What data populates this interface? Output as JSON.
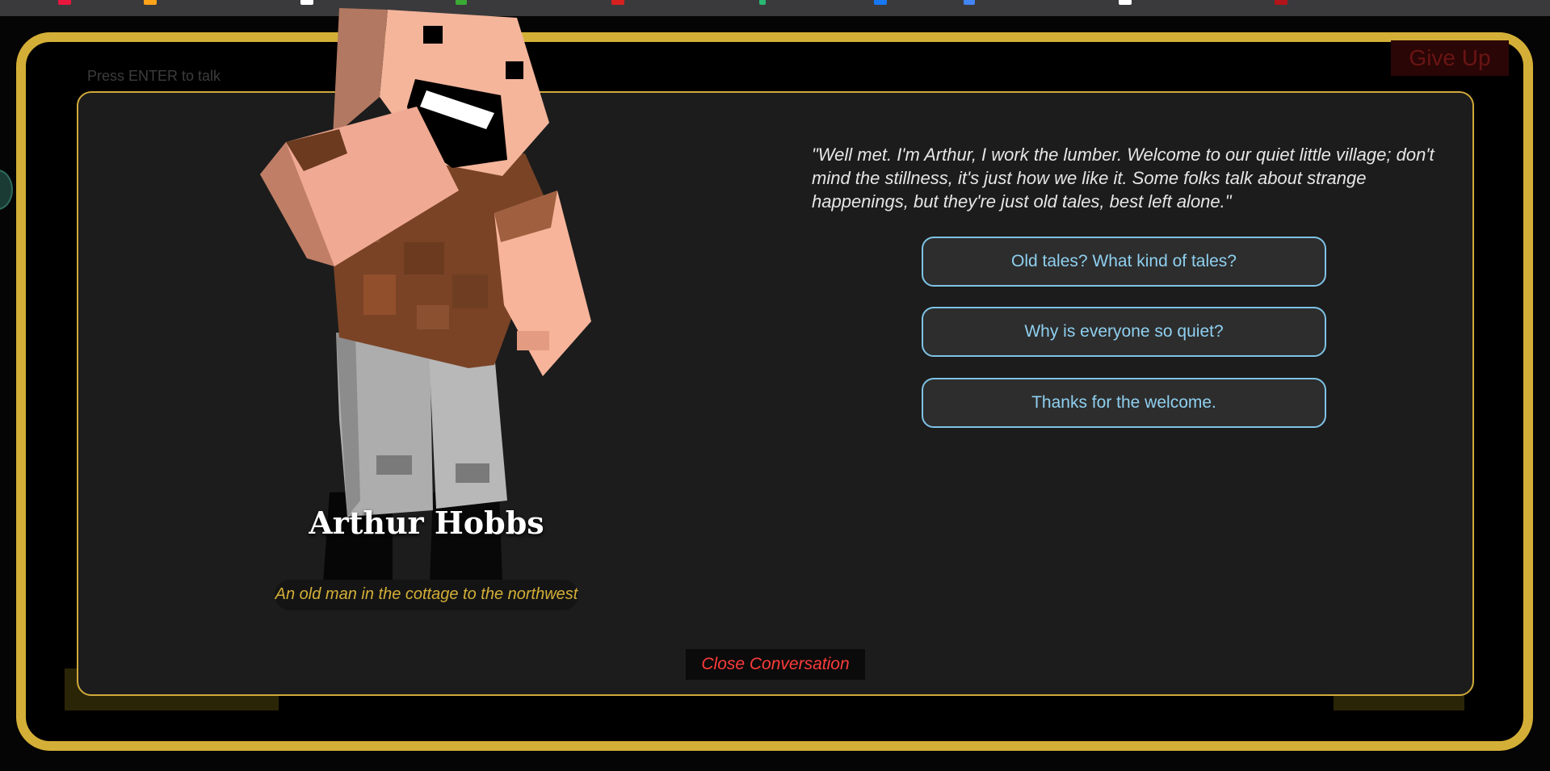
{
  "game": {
    "hint": "Press ENTER to talk",
    "give_up_label": "Give Up"
  },
  "npc": {
    "name": "Arthur Hobbs",
    "description": "An old man in the cottage to the northwest"
  },
  "dialog": {
    "speech": "\"Well met. I'm Arthur, I work the lumber. Welcome to our quiet little village; don't mind the stillness, it's just how we like it. Some folks talk about strange happenings, but they're just old tales, best left alone.\"",
    "choices": [
      {
        "label": "Old tales? What kind of tales?"
      },
      {
        "label": "Why is everyone so quiet?"
      },
      {
        "label": "Thanks for the welcome."
      }
    ],
    "close_label": "Close Conversation"
  },
  "colors": {
    "frame_gold": "#d4af37",
    "choice_border": "#7ec3e6",
    "close_red": "#ff3b3b"
  }
}
